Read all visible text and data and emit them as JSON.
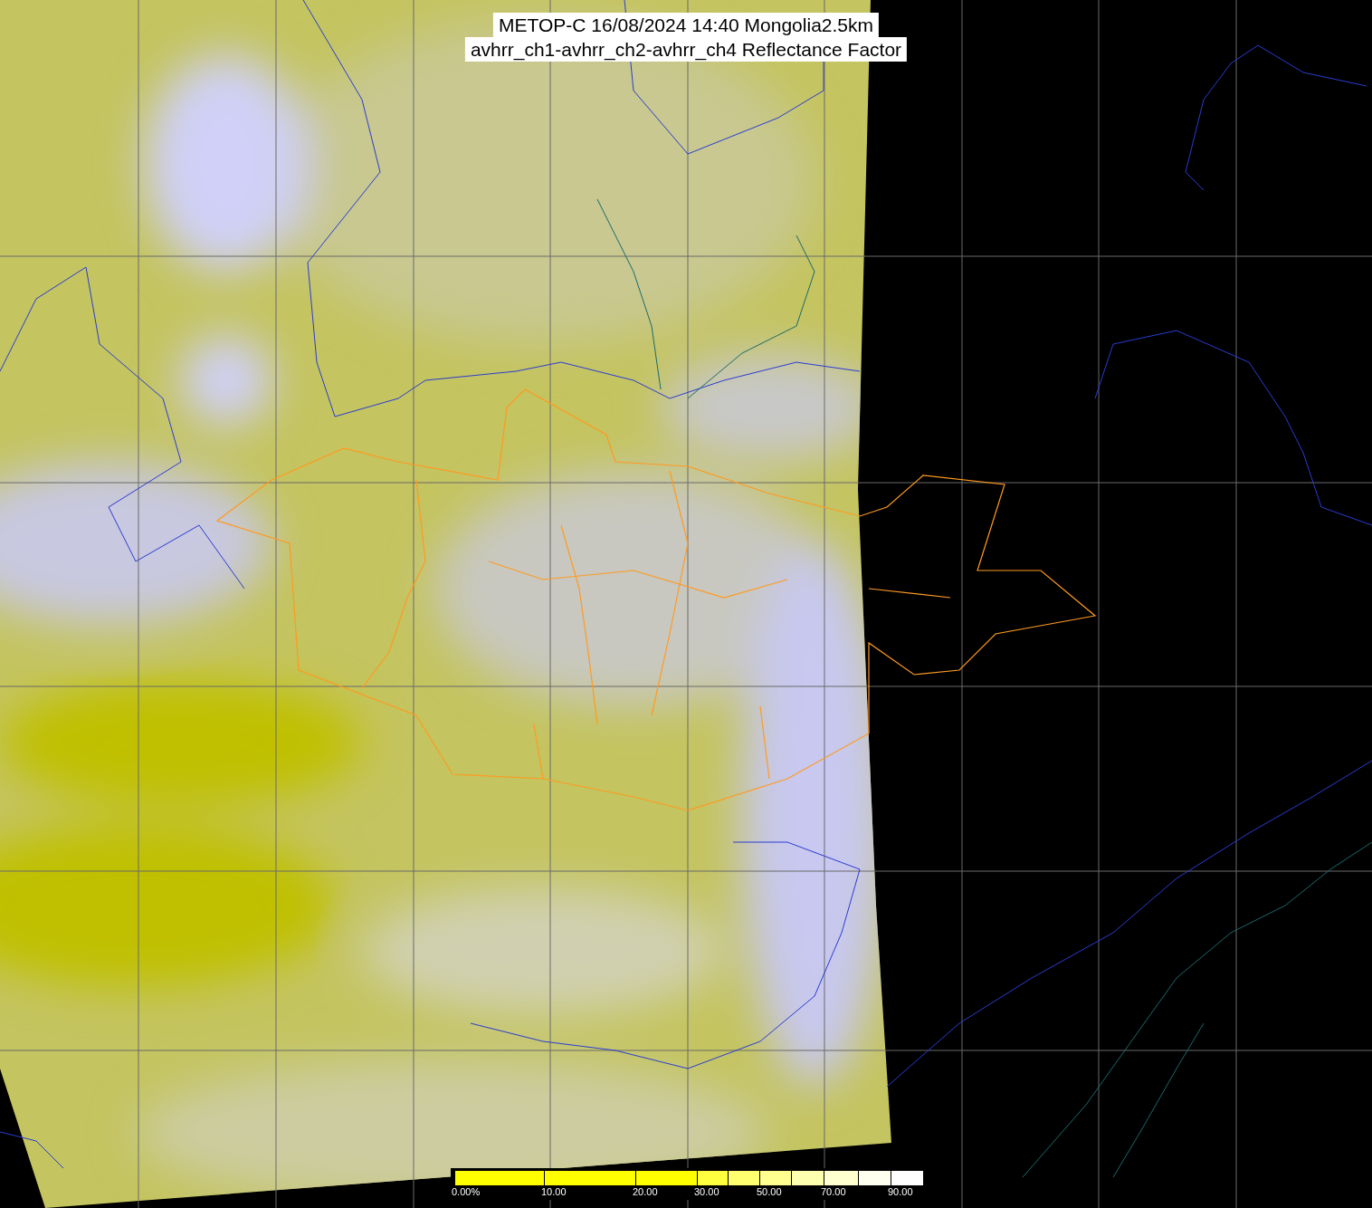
{
  "title": {
    "lines": [
      "METOP-C 16/08/2024 14:40 Mongolia2.5km",
      "avhrr_ch1-avhrr_ch2-avhrr_ch4 Reflectance Factor"
    ]
  },
  "legend": {
    "segments": [
      {
        "color": "#ffff00",
        "label": "0.00%"
      },
      {
        "color": "#ffff00",
        "label": "10.00"
      },
      {
        "color": "#ffff00",
        "label": "20.00"
      },
      {
        "color": "#ffff40",
        "label": "30.00"
      },
      {
        "color": "#ffff70"
      },
      {
        "color": "#ffff90",
        "label": "50.00"
      },
      {
        "color": "#ffffb0"
      },
      {
        "color": "#ffffd0",
        "label": "70.00"
      },
      {
        "color": "#fffff0"
      },
      {
        "color": "#ffffff",
        "label": "90.00"
      }
    ]
  }
}
